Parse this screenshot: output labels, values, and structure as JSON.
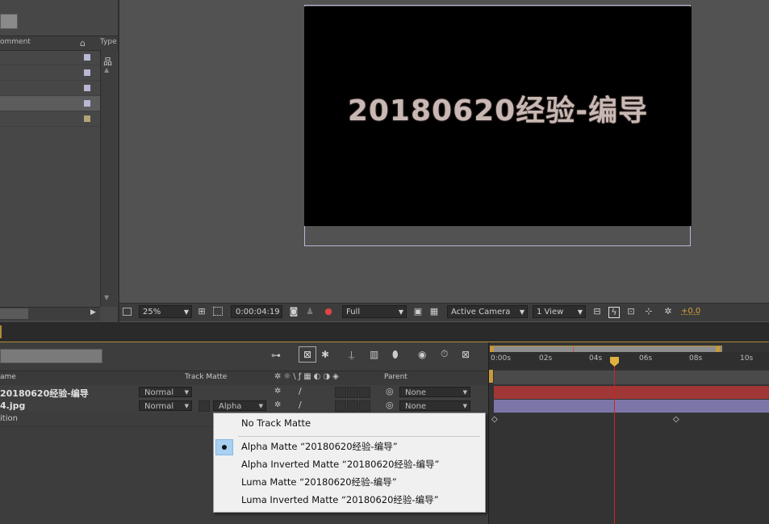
{
  "project": {
    "col_comment": "omment",
    "col_type": "Type"
  },
  "composition": {
    "text": "20180620经验-编导"
  },
  "viewer_toolbar": {
    "zoom": "25%",
    "timecode": "0:00:04:19",
    "resolution": "Full",
    "camera": "Active Camera",
    "views": "1 View",
    "exposure": "+0.0"
  },
  "timeline": {
    "col_name": "ame",
    "col_track_matte": "Track Matte",
    "col_parent": "Parent",
    "ruler_ticks": [
      "0:00s",
      "02s",
      "04s",
      "06s",
      "08s",
      "10s"
    ],
    "layers": [
      {
        "name": "20180620经验-编导",
        "mode": "Normal",
        "parent": "None"
      },
      {
        "name": "4.jpg",
        "mode": "Normal",
        "track_matte": "Alpha",
        "parent": "None"
      }
    ],
    "property_row": "ition"
  },
  "menu": {
    "items": [
      "No Track Matte",
      "Alpha Matte “20180620经验-编导”",
      "Alpha Inverted Matte “20180620经验-编导”",
      "Luma Matte “20180620经验-编导”",
      "Luma Inverted Matte “20180620经验-编导”"
    ],
    "selected_index": 1
  },
  "colors": {
    "layer1_bar": "#a13636",
    "layer2_bar": "#7c76a8",
    "playhead": "#d42020",
    "accent": "#e0b040"
  }
}
